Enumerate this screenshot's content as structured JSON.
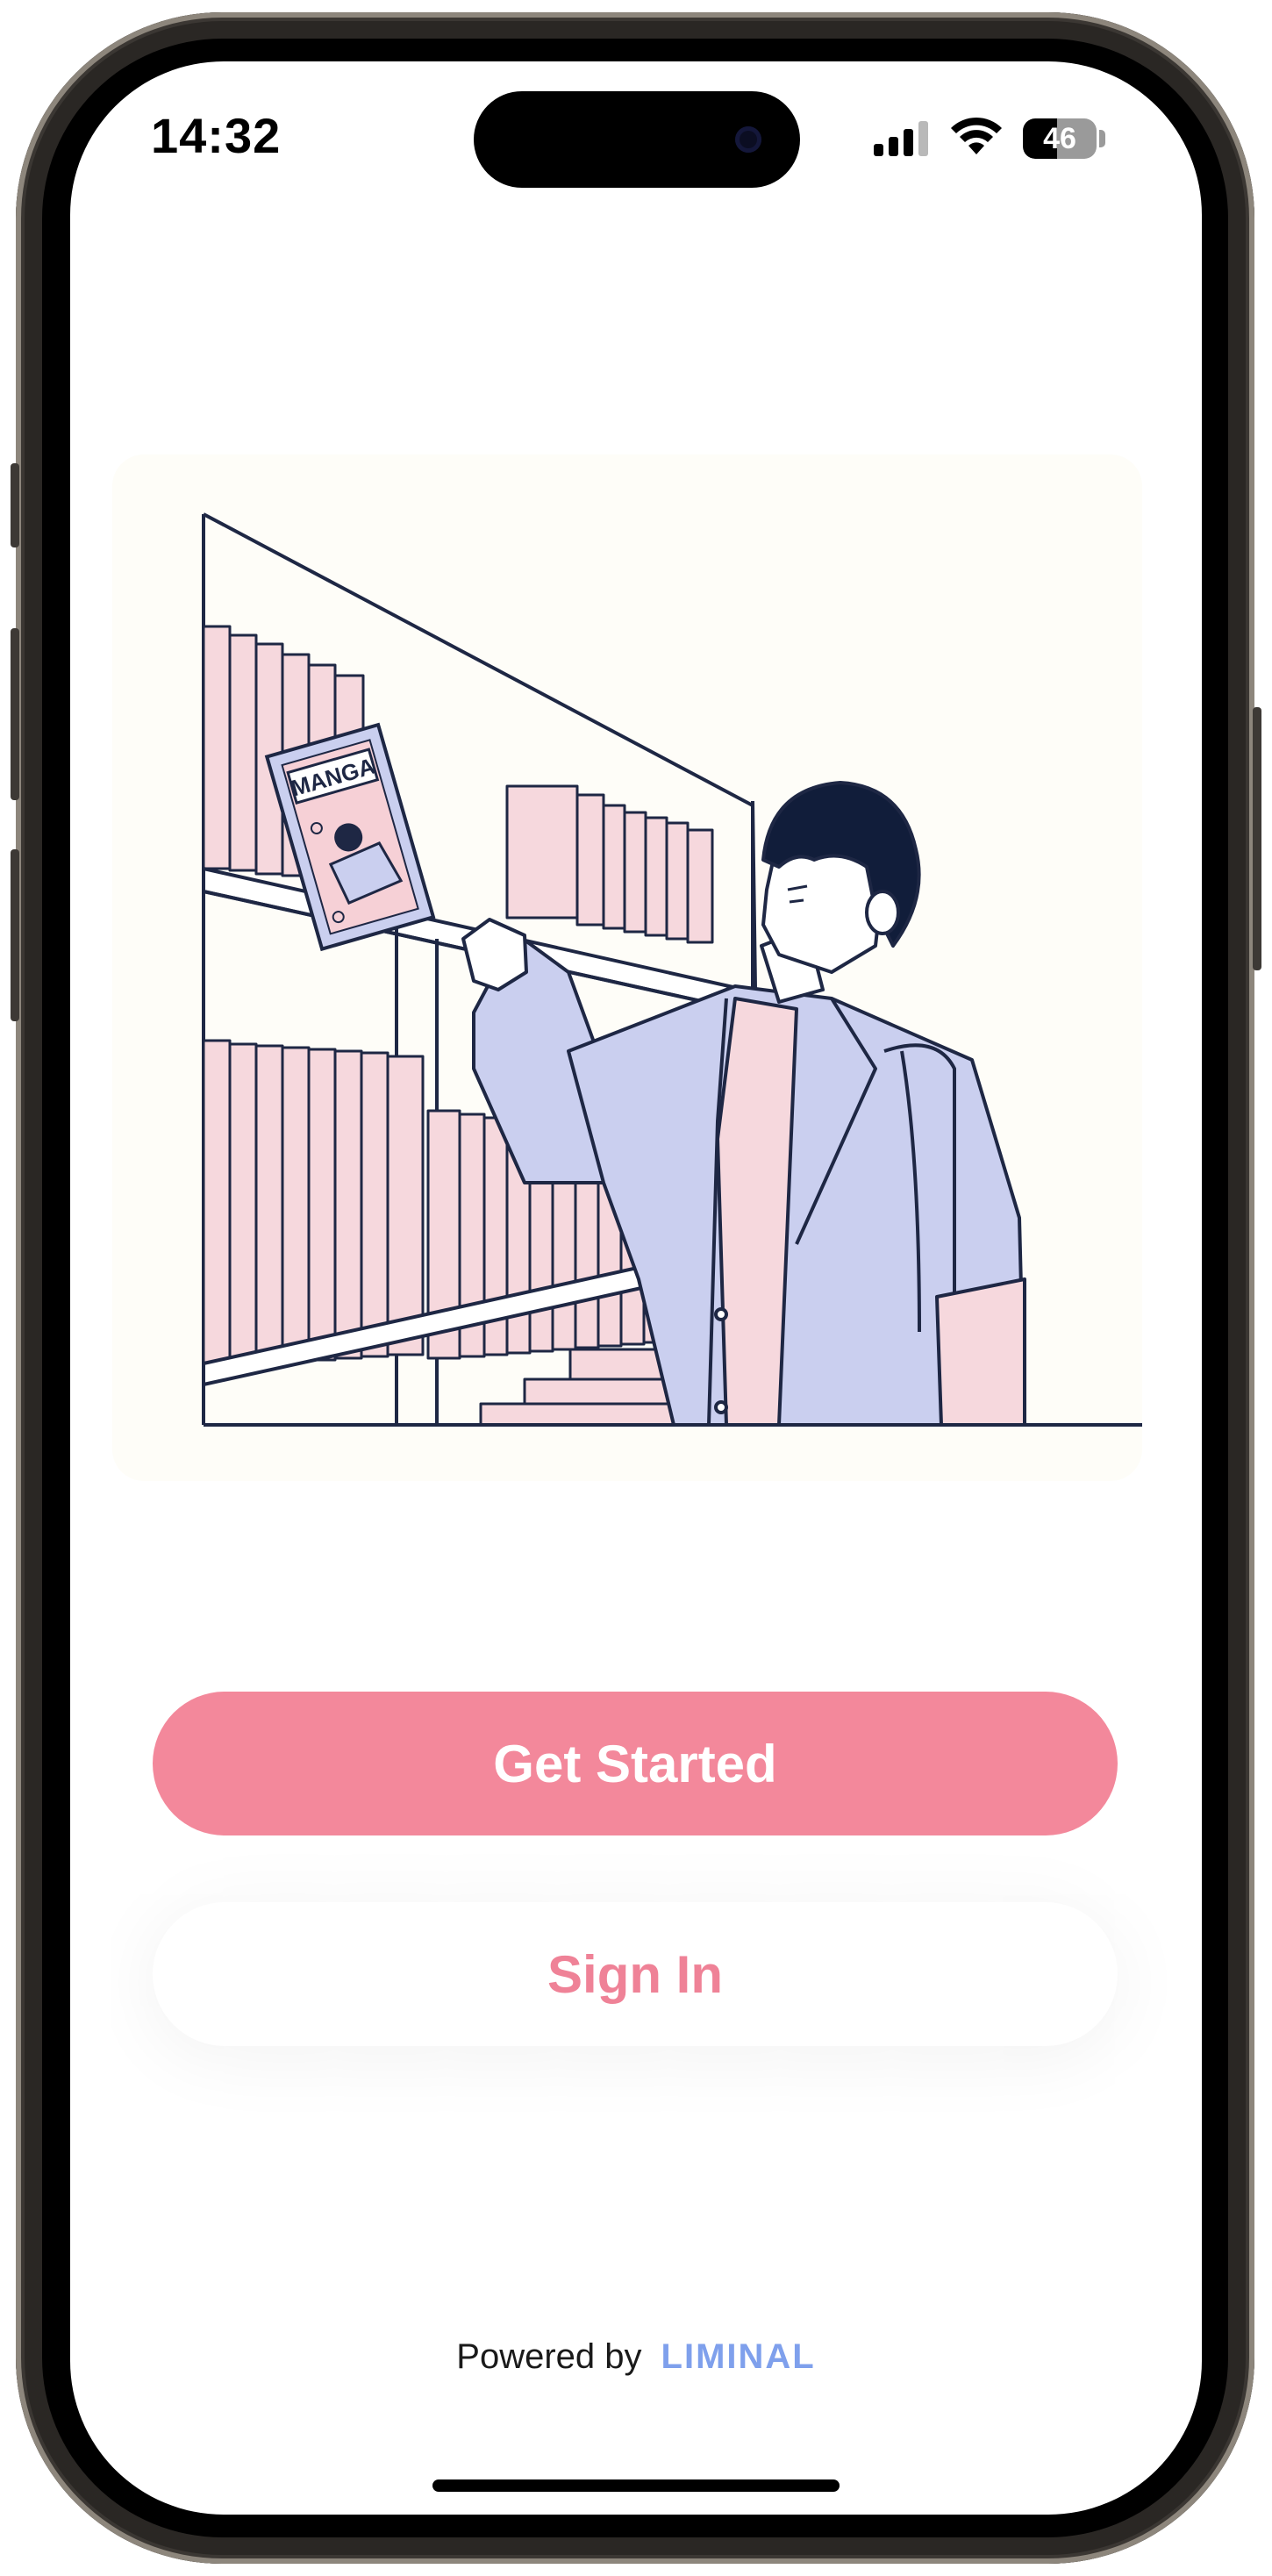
{
  "status_bar": {
    "time": "14:32",
    "battery_level": "46",
    "battery_fraction": 0.46,
    "icons": [
      "cellular-signal-icon",
      "wifi-icon",
      "battery-icon"
    ]
  },
  "illustration": {
    "book_cover_text": "MANGA",
    "description_icon": "person-picking-manga-illustration"
  },
  "actions": {
    "get_started_label": "Get Started",
    "sign_in_label": "Sign In"
  },
  "footer": {
    "powered_by": "Powered by",
    "brand": "LIMINAL"
  },
  "colors": {
    "primary": "#F3889B",
    "secondary_text": "#EF8297",
    "brand": "#7FA0EC",
    "shelf_books": "#F6D8DD",
    "jacket": "#CACFEF"
  }
}
